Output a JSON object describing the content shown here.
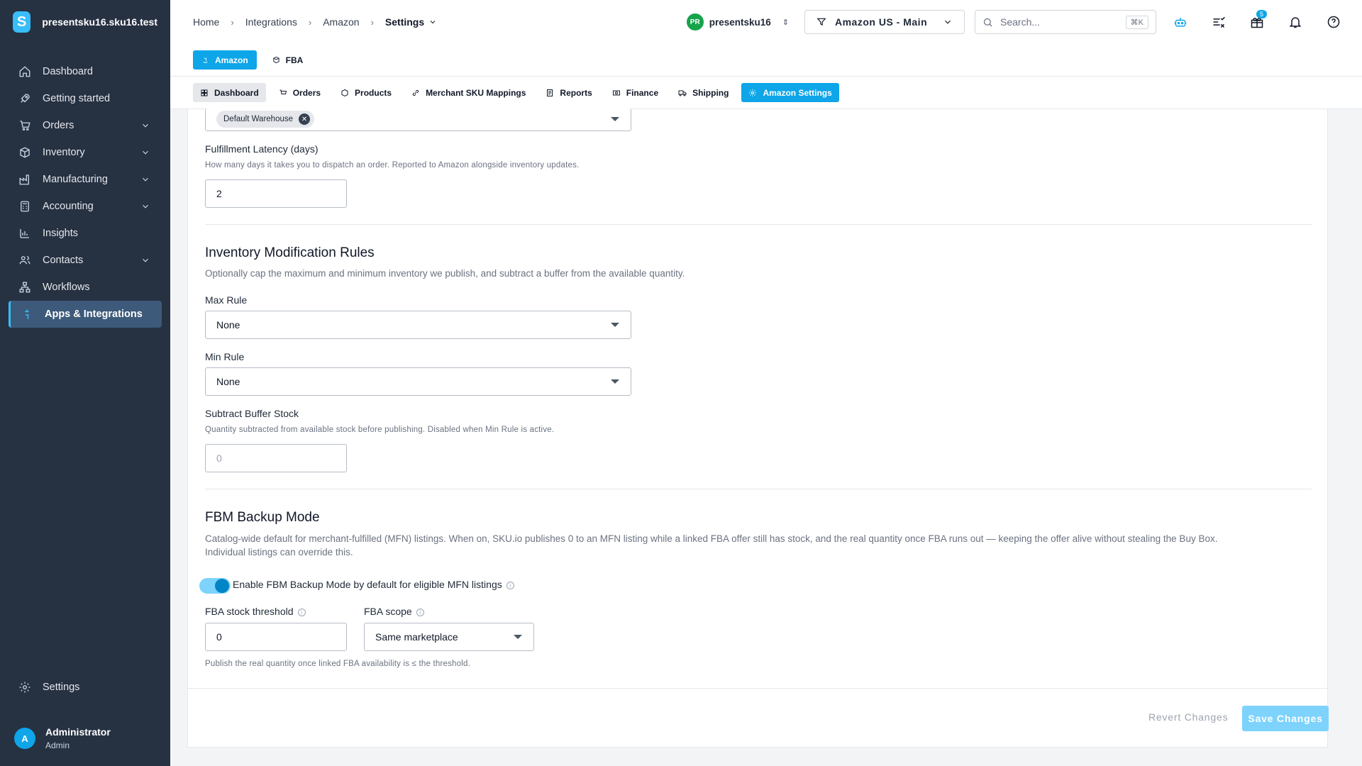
{
  "brand": {
    "name": "presentsku16.sku16.test"
  },
  "sidebar": {
    "items": [
      {
        "label": "Dashboard",
        "icon": "home-icon"
      },
      {
        "label": "Getting started",
        "icon": "rocket-icon"
      },
      {
        "label": "Orders",
        "icon": "cart-icon"
      },
      {
        "label": "Inventory",
        "icon": "box-icon"
      },
      {
        "label": "Manufacturing",
        "icon": "factory-icon"
      },
      {
        "label": "Accounting",
        "icon": "calculator-icon"
      },
      {
        "label": "Insights",
        "icon": "chart-icon"
      },
      {
        "label": "Contacts",
        "icon": "contacts-icon"
      },
      {
        "label": "Workflows",
        "icon": "workflow-icon"
      },
      {
        "label": "Apps & Integrations",
        "icon": "apps-icon"
      }
    ],
    "settings_label": "Settings",
    "user_name": "Administrator",
    "user_role": "Admin",
    "user_initial": "A"
  },
  "breadcrumb": {
    "home": "Home",
    "integrations": "Integrations",
    "amazon": "Amazon",
    "settings": "Settings"
  },
  "header": {
    "company_initials": "PR",
    "company_name": "presentsku16",
    "store": "Amazon US - Main",
    "search_placeholder": "Search...",
    "search_shortcut": "⌘K",
    "gift_badge": "5"
  },
  "subnav": {
    "amazon": "Amazon",
    "fba": "FBA"
  },
  "tabs": {
    "dashboard": "Dashboard",
    "orders": "Orders",
    "products": "Products",
    "merchant_sku": "Merchant SKU Mappings",
    "reports": "Reports",
    "finance": "Finance",
    "shipping": "Shipping",
    "amazon_settings": "Amazon Settings"
  },
  "form": {
    "warehouse_chip": "Default Warehouse",
    "latency_label": "Fulfillment Latency (days)",
    "latency_help": "How many days it takes you to dispatch an order. Reported to Amazon alongside inventory updates.",
    "latency_value": "2",
    "rules_title": "Inventory Modification Rules",
    "rules_desc": "Optionally cap the maximum and minimum inventory we publish, and subtract a buffer from the available quantity.",
    "max_rule_label": "Max Rule",
    "max_rule_value": "None",
    "min_rule_label": "Min Rule",
    "min_rule_value": "None",
    "buffer_label": "Subtract Buffer Stock",
    "buffer_help": "Quantity subtracted from available stock before publishing. Disabled when Min Rule is active.",
    "buffer_placeholder": "0",
    "fbm_title": "FBM Backup Mode",
    "fbm_desc_1": "Catalog-wide default for merchant-fulfilled (MFN) listings. When on, SKU.io publishes 0 to an MFN listing while a linked FBA offer still has stock, and the real quantity once FBA runs out — keeping the offer alive without stealing the Buy Box.",
    "fbm_desc_2": "Individual listings can override this.",
    "fbm_toggle_label": "Enable FBM Backup Mode by default for eligible MFN listings",
    "fbm_enabled": true,
    "threshold_label": "FBA stock threshold",
    "threshold_value": "0",
    "scope_label": "FBA scope",
    "scope_value": "Same marketplace",
    "threshold_help": "Publish the real quantity once linked FBA availability is ≤ the threshold."
  },
  "actions": {
    "revert": "Revert Changes",
    "save": "Save Changes"
  }
}
